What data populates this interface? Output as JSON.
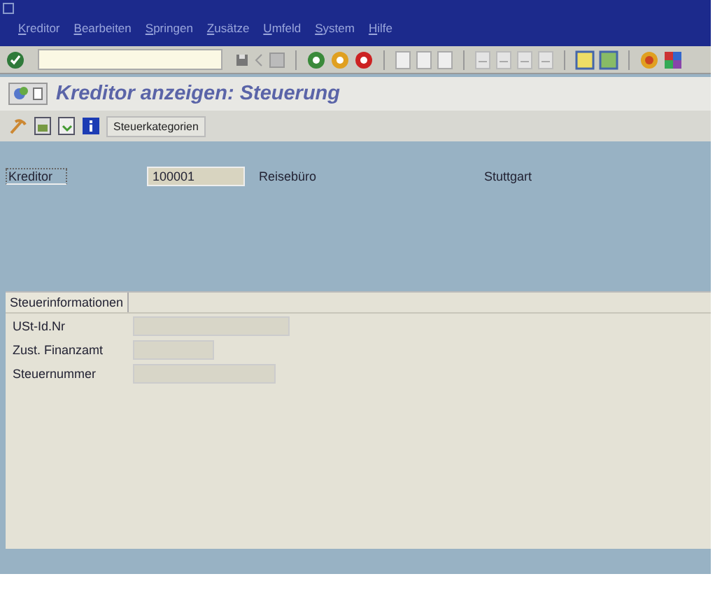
{
  "menu": [
    {
      "label": "Kreditor"
    },
    {
      "label": "Bearbeiten"
    },
    {
      "label": "Springen"
    },
    {
      "label": "Zusätze"
    },
    {
      "label": "Umfeld"
    },
    {
      "label": "System"
    },
    {
      "label": "Hilfe"
    }
  ],
  "title": "Kreditor anzeigen: Steuerung",
  "app_toolbar": {
    "buttons": [
      "Steuerkategorien"
    ]
  },
  "header": {
    "label": "Kreditor",
    "number": "100001",
    "name": "Reisebüro",
    "city": "Stuttgart"
  },
  "group": {
    "title": "Steuerinformationen",
    "fields": [
      {
        "label": "USt-Id.Nr"
      },
      {
        "label": "Zust. Finanzamt"
      },
      {
        "label": "Steuernummer"
      }
    ]
  }
}
